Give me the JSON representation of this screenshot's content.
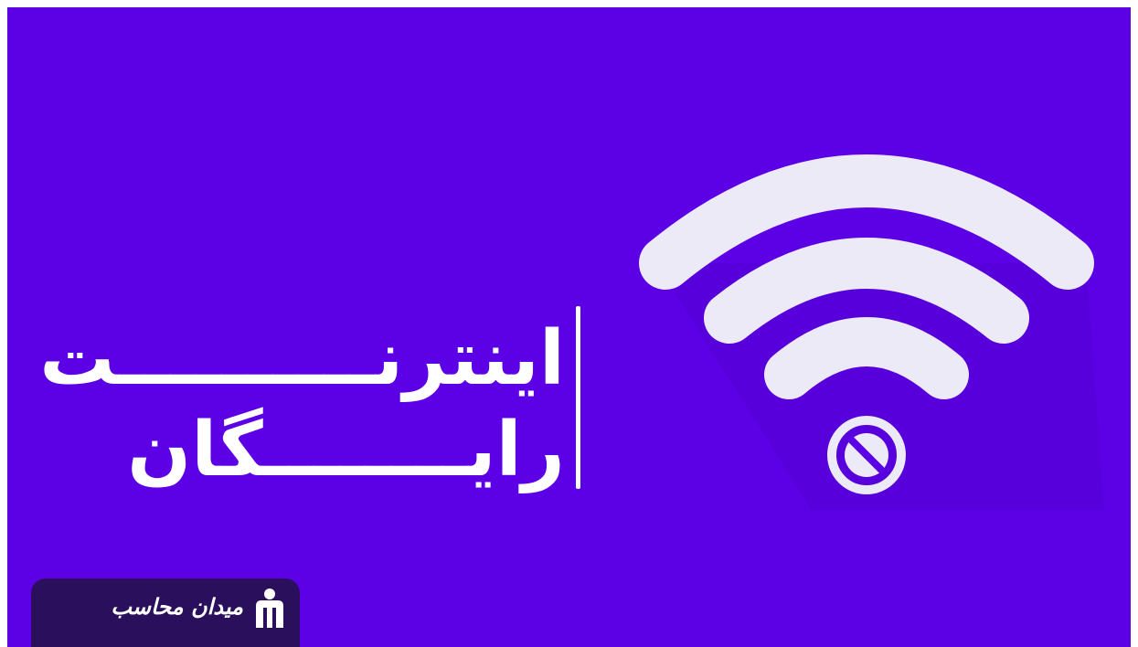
{
  "banner": {
    "title_line1": "اینترنــــــــــت",
    "title_line2": "رایــــــــگان"
  },
  "icons": {
    "wifi": "wifi-icon",
    "blocked": "blocked-icon",
    "logo": "logo-icon"
  },
  "logo": {
    "text": "میدان محاسب"
  },
  "colors": {
    "background": "#5c00e6",
    "icon": "#eceaf6",
    "logo_badge": "#2a0f5c",
    "text": "#ffffff"
  }
}
